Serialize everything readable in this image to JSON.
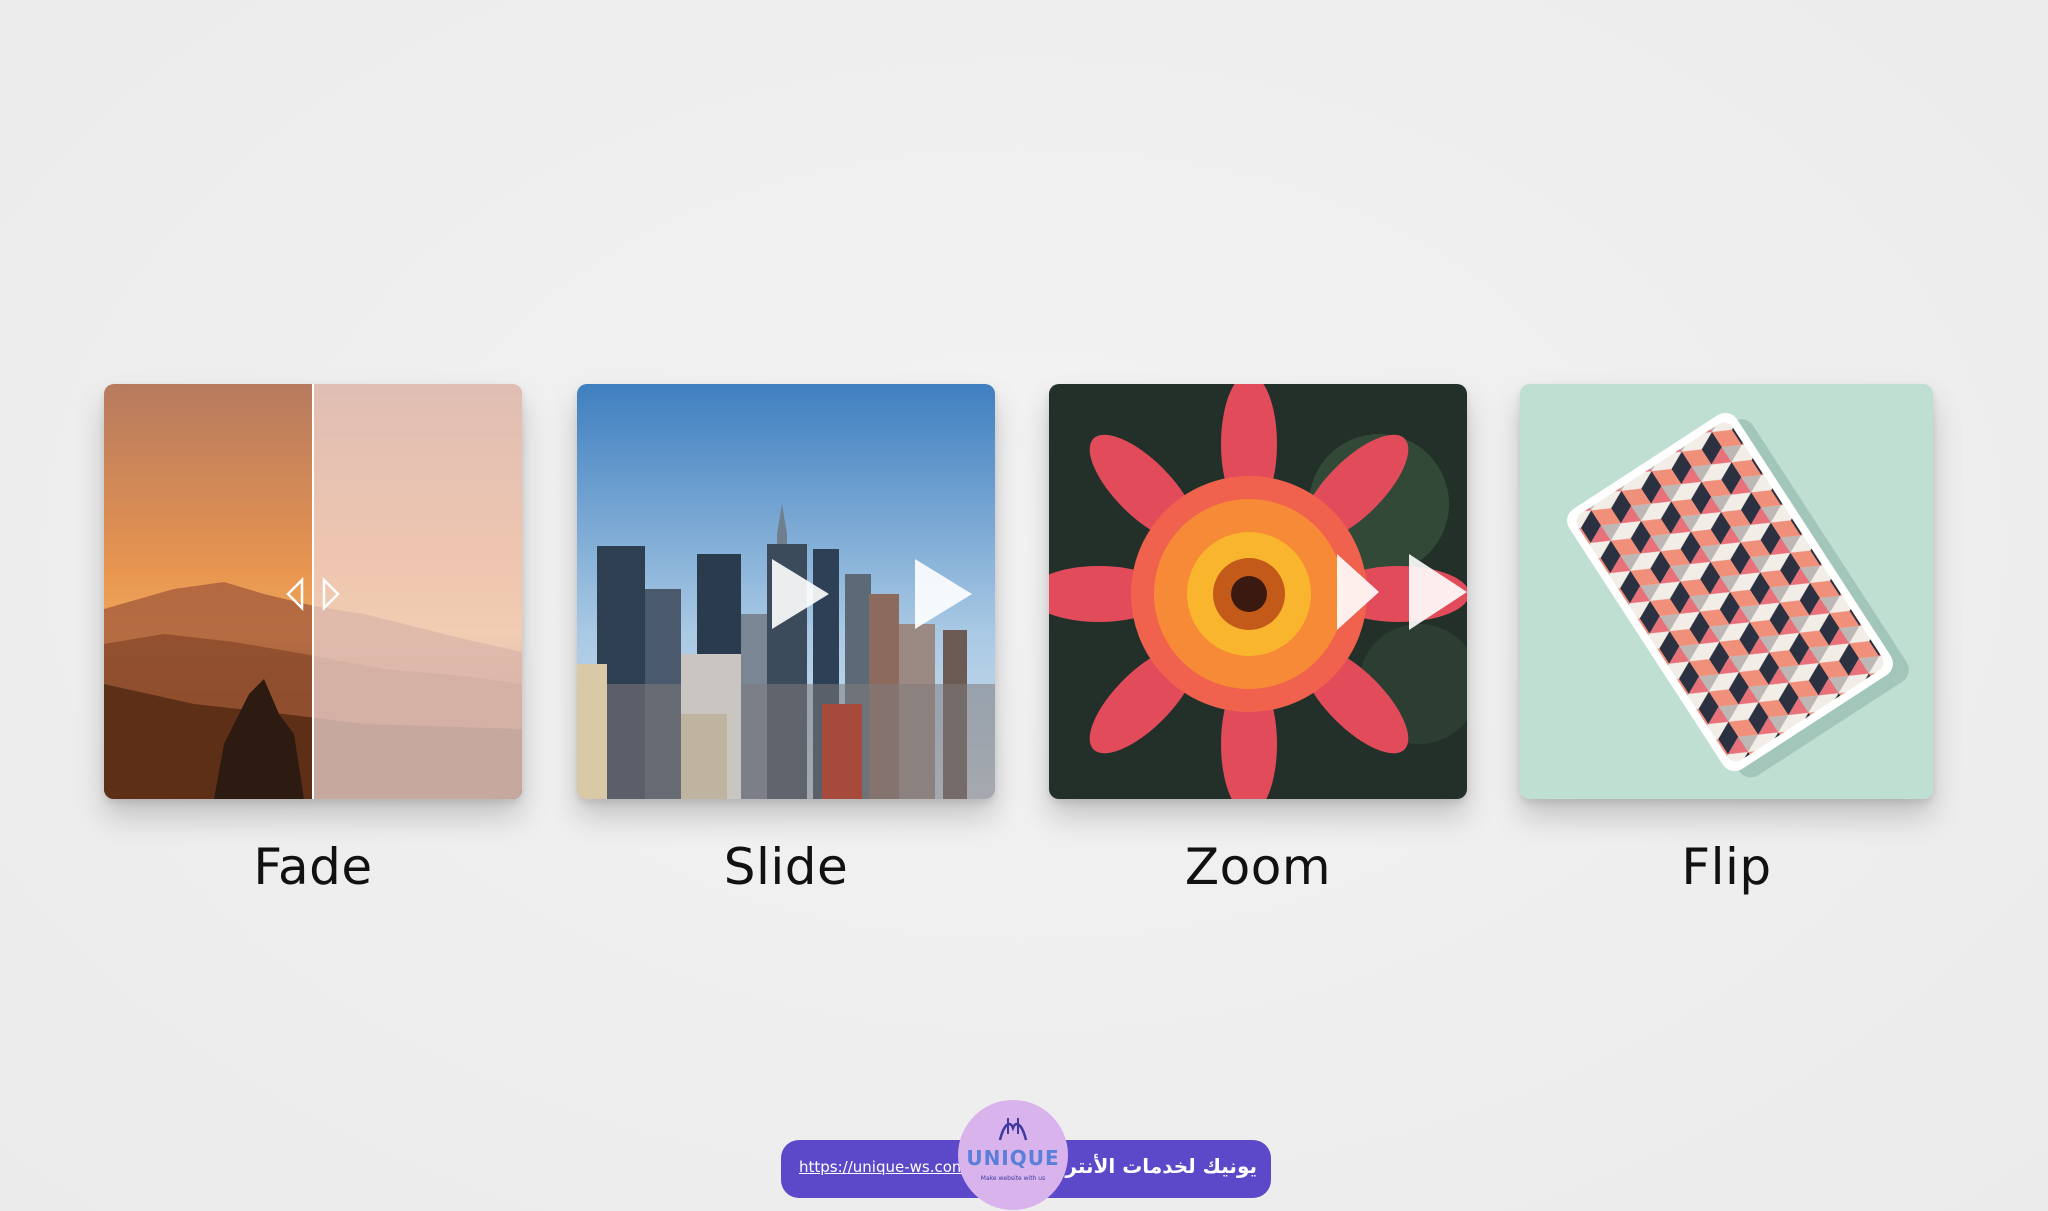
{
  "cards": [
    {
      "label": "Fade",
      "icon": "fade-divider-icon"
    },
    {
      "label": "Slide",
      "icon": "play-arrows-icon"
    },
    {
      "label": "Zoom",
      "icon": "play-arrows-icon"
    },
    {
      "label": "Flip",
      "icon": "flip-card-icon"
    }
  ],
  "footer": {
    "url": "https://unique-ws.com",
    "brand_arabic": "يونيك لخدمات الأنترنت",
    "logo_word": "UNIQUE",
    "logo_tagline": "Make website with us",
    "colors": {
      "badge": "#5b49c9",
      "logo_circle": "#d9b3ec"
    }
  }
}
